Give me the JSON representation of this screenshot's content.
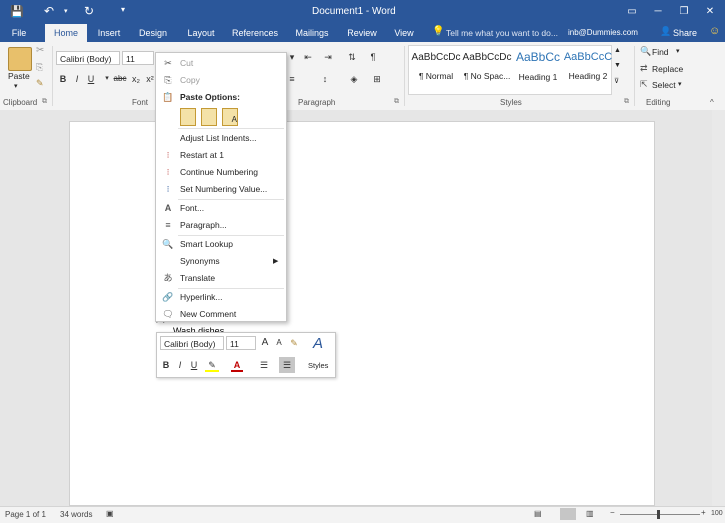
{
  "title_bar": {
    "title": "Document1 - Word",
    "undo_icon": "undo-icon",
    "redo_icon": "redo-icon",
    "save_icon": "save-icon",
    "minimize": "─",
    "restore": "❐",
    "close": "✕",
    "ribbon_options": "▭"
  },
  "tabs": [
    {
      "label": "File"
    },
    {
      "label": "Home"
    },
    {
      "label": "Insert"
    },
    {
      "label": "Design"
    },
    {
      "label": "Layout"
    },
    {
      "label": "References"
    },
    {
      "label": "Mailings"
    },
    {
      "label": "Review"
    },
    {
      "label": "View"
    }
  ],
  "tell_me": "Tell me what you want to do...",
  "account": "inb@Dummies.com",
  "share_label": "Share",
  "ribbon": {
    "clipboard": {
      "paste_label": "Paste",
      "group_label": "Clipboard"
    },
    "font": {
      "font_name": "Calibri (Body)",
      "font_size": "11",
      "group_label": "Font",
      "bold": "B",
      "italic": "I",
      "underline": "U",
      "strike": "abc",
      "subscript": "x₂",
      "superscript": "x²"
    },
    "paragraph": {
      "group_label": "Paragraph"
    },
    "styles": {
      "group_label": "Styles",
      "items": [
        {
          "sample": "AaBbCcDc",
          "name": "¶ Normal"
        },
        {
          "sample": "AaBbCcDc",
          "name": "¶ No Spac..."
        },
        {
          "sample": "AaBbCc",
          "name": "Heading 1"
        },
        {
          "sample": "AaBbCcC",
          "name": "Heading 2"
        }
      ]
    },
    "editing": {
      "find": "Find",
      "replace": "Replace",
      "select": "Select",
      "group_label": "Editing"
    }
  },
  "context_menu": {
    "cut": "Cut",
    "copy": "Copy",
    "paste_options": "Paste Options:",
    "adjust_list_indents": "Adjust List Indents...",
    "restart_at_1": "Restart at 1",
    "continue_numbering": "Continue Numbering",
    "set_numbering_value": "Set Numbering Value...",
    "font": "Font...",
    "paragraph": "Paragraph...",
    "smart_lookup": "Smart Lookup",
    "synonyms": "Synonyms",
    "translate": "Translate",
    "hyperlink": "Hyperlink...",
    "new_comment": "New Comment"
  },
  "document": {
    "text": "Wash dishes"
  },
  "mini_toolbar": {
    "font_name": "Calibri (Body)",
    "font_size": "11",
    "bold": "B",
    "italic": "I",
    "underline": "U",
    "styles": "Styles"
  },
  "status_bar": {
    "page": "Page 1 of 1",
    "words": "34 words",
    "zoom": "100"
  },
  "colors": {
    "brand": "#2b579a",
    "ribbon_bg": "#f3f3f3",
    "doc_bg": "#e6e6e6"
  }
}
